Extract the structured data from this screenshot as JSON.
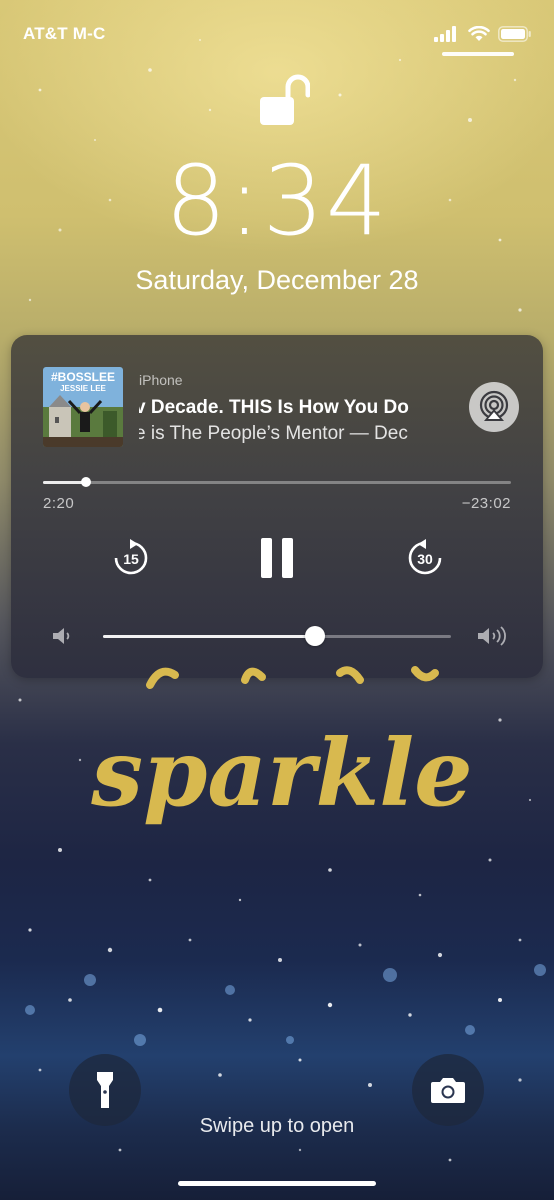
{
  "status_bar": {
    "carrier": "AT&T M-C",
    "icons": [
      "cellular-signal-icon",
      "wifi-icon",
      "battery-icon"
    ]
  },
  "lock_screen": {
    "lock_state_icon": "unlocked-padlock-icon",
    "time": "8:34",
    "date": "Saturday, December 28"
  },
  "now_playing": {
    "artwork_text": "#BOSSLEE JESSIE LEE",
    "device": "iPhone",
    "title": "v Decade. THIS Is How You Do",
    "artist": "e is The People’s Mentor — Dec",
    "airplay_icon": "airplay-icon",
    "elapsed": "2:20",
    "remaining": "−23:02",
    "progress_fraction": 0.092,
    "skip_back_seconds": "15",
    "skip_forward_seconds": "30",
    "volume_fraction": 0.61
  },
  "wallpaper": {
    "text": "sparkle"
  },
  "bottom": {
    "flashlight_icon": "flashlight-icon",
    "camera_icon": "camera-icon",
    "hint": "Swipe up to open"
  },
  "colors": {
    "gold": "#e0c25a",
    "panel": "#3f3f45"
  }
}
